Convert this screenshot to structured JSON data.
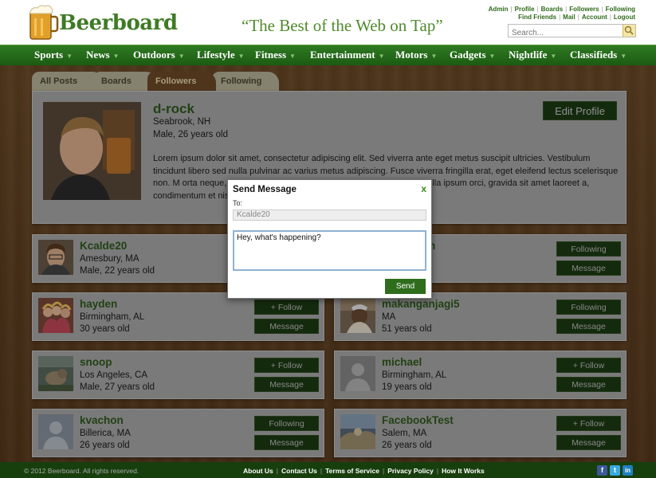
{
  "header": {
    "logo_text": "Beerboard",
    "tagline": "“The Best of the Web on Tap”",
    "links_row1": [
      "Admin",
      "Profile",
      "Boards",
      "Followers",
      "Following"
    ],
    "links_row2": [
      "Find Friends",
      "Mail",
      "Account",
      "Logout"
    ],
    "search_placeholder": "Search..."
  },
  "nav": [
    "Sports",
    "News",
    "Outdoors",
    "Lifestyle",
    "Fitness",
    "Entertainment",
    "Motors",
    "Gadgets",
    "Nightlife",
    "Classifieds"
  ],
  "tabs": [
    "All Posts",
    "Boards",
    "Followers",
    "Following"
  ],
  "profile": {
    "name": "d-rock",
    "location": "Seabrook, NH",
    "info": "Male, 26 years old",
    "edit_label": "Edit Profile",
    "bio": "Lorem ipsum dolor sit amet, consectetur adipiscing elit. Sed viverra ante eget metus suscipit ultricies. Vestibulum tincidunt libero sed nulla pulvinar ac varius metus adipiscing. Fusce viverra fringilla erat, eget eleifend lectus scelerisque non. M                                                          orta neque, vel convallis ipsum vehicula sit amet. Curabitur dig                                                           ulla ipsum orci, gravida sit amet laoreet a, condimentum et nis"
  },
  "users": [
    {
      "name": "Kcalde20",
      "location": "Amesbury, MA",
      "info": "Male, 22 years old",
      "btn1": "",
      "btn2": ""
    },
    {
      "name": "n",
      "location": "",
      "info": "",
      "btn1": "Following",
      "btn2": "Message"
    },
    {
      "name": "hayden",
      "location": "Birmingham, AL",
      "info": "30 years old",
      "btn1": "+ Follow",
      "btn2": "Message"
    },
    {
      "name": "makanganjagi5",
      "location": "MA",
      "info": "51 years old",
      "btn1": "Following",
      "btn2": "Message"
    },
    {
      "name": "snoop",
      "location": "Los Angeles, CA",
      "info": "Male, 27 years old",
      "btn1": "+ Follow",
      "btn2": "Message"
    },
    {
      "name": "michael",
      "location": "Birmingham, AL",
      "info": "19 years old",
      "btn1": "+ Follow",
      "btn2": "Message"
    },
    {
      "name": "kvachon",
      "location": "Billerica, MA",
      "info": "26 years old",
      "btn1": "Following",
      "btn2": "Message"
    },
    {
      "name": "FacebookTest",
      "location": "Salem, MA",
      "info": "26 years old",
      "btn1": "+ Follow",
      "btn2": "Message"
    }
  ],
  "modal": {
    "title": "Send Message",
    "close": "x",
    "to_label": "To:",
    "to_value": "Kcalde20",
    "message": "Hey, what's happening?",
    "send_label": "Send"
  },
  "footer": {
    "copyright": "© 2012 Beerboard. All rights reserved.",
    "links": [
      "About Us",
      "Contact Us",
      "Terms of Service",
      "Privacy Policy",
      "How It Works"
    ],
    "social": [
      "f",
      "t",
      "in"
    ]
  },
  "colors": {
    "brand_green": "#2f7a22",
    "dark_button": "#1c3b12",
    "wood": "#6b4a26",
    "facebook": "#3b5998",
    "twitter": "#3aa9e0",
    "linkedin": "#1f7fbf"
  }
}
